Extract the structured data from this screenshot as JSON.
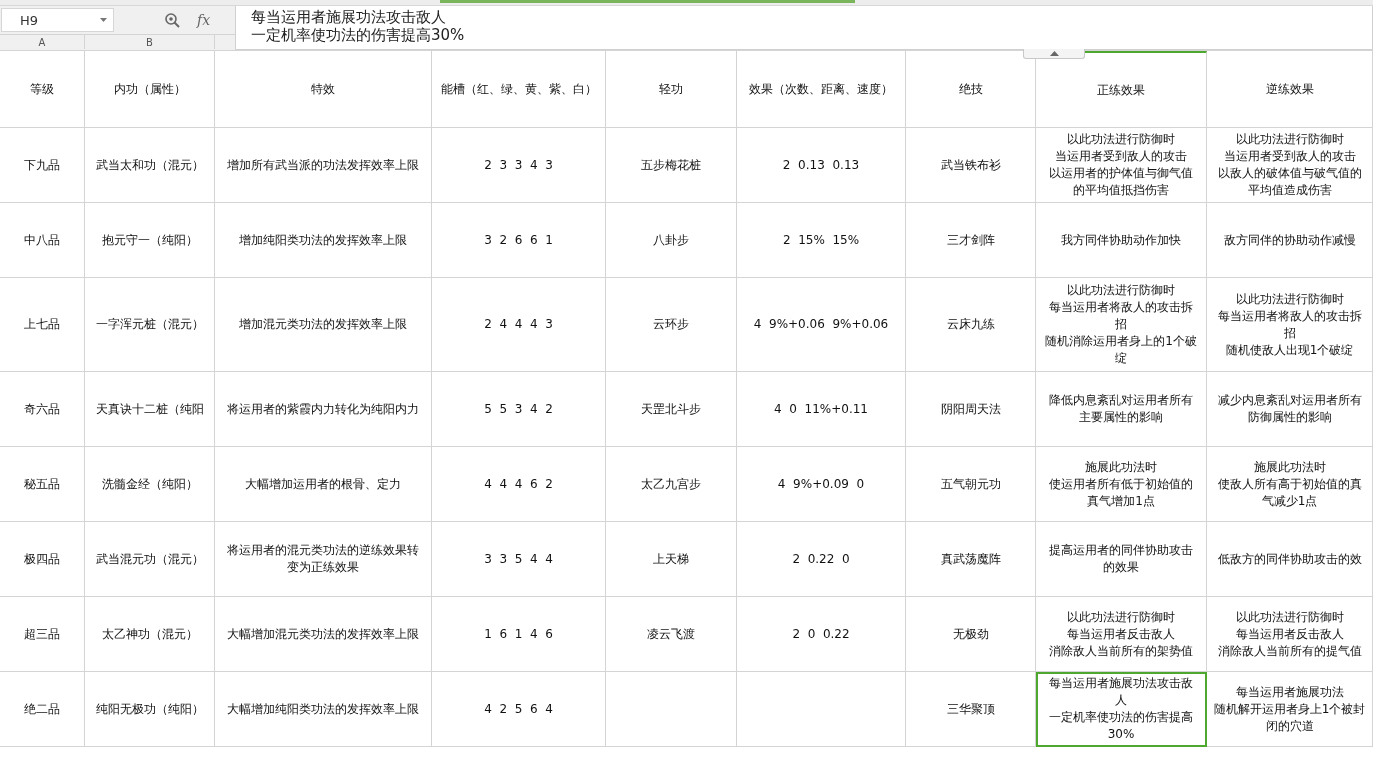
{
  "formula_bar": {
    "cell_ref": "H9",
    "function_button": "fx",
    "content_lines": [
      "每当运用者施展功法攻击敌人",
      "一定机率使功法的伤害提高30%"
    ]
  },
  "column_headers": [
    "A",
    "B"
  ],
  "sheet": {
    "header": [
      "等级",
      "内功（属性）",
      "特效",
      "能槽（红、绿、黄、紫、白）",
      "轻功",
      "效果（次数、距离、速度）",
      "绝技",
      "正练效果",
      "逆练效果"
    ],
    "rows": [
      {
        "cells": [
          {
            "lines": [
              "下九品"
            ],
            "selected": false
          },
          {
            "lines": [
              "武当太和功（混元）"
            ],
            "selected": false
          },
          {
            "lines": [
              "增加所有武当派的功法发挥效率上限"
            ],
            "selected": false
          },
          {
            "lines": [
              "2  3  3  4  3"
            ],
            "selected": false
          },
          {
            "lines": [
              "五步梅花桩"
            ],
            "selected": false
          },
          {
            "lines": [
              "2  0.13  0.13"
            ],
            "selected": false
          },
          {
            "lines": [
              "武当铁布衫"
            ],
            "selected": false
          },
          {
            "lines": [
              "以此功法进行防御时",
              "当运用者受到敌人的攻击",
              "以运用者的护体值与御气值",
              "的平均值抵挡伤害"
            ],
            "selected": false
          },
          {
            "lines": [
              "以此功法进行防御时",
              "当运用者受到敌人的攻击",
              "以敌人的破体值与破气值的",
              "平均值造成伤害"
            ],
            "selected": false
          }
        ]
      },
      {
        "cells": [
          {
            "lines": [
              "中八品"
            ],
            "selected": false
          },
          {
            "lines": [
              "抱元守一（纯阳）"
            ],
            "selected": false
          },
          {
            "lines": [
              "增加纯阳类功法的发挥效率上限"
            ],
            "selected": false
          },
          {
            "lines": [
              "3  2  6  6  1"
            ],
            "selected": false
          },
          {
            "lines": [
              "八卦步"
            ],
            "selected": false
          },
          {
            "lines": [
              "2  15%  15%"
            ],
            "selected": false
          },
          {
            "lines": [
              "三才剑阵"
            ],
            "selected": false
          },
          {
            "lines": [
              "我方同伴协助动作加快"
            ],
            "selected": false
          },
          {
            "lines": [
              "敌方同伴的协助动作减慢"
            ],
            "selected": false
          }
        ]
      },
      {
        "cells": [
          {
            "lines": [
              "上七品"
            ],
            "selected": false
          },
          {
            "lines": [
              "一字浑元桩（混元）"
            ],
            "selected": false
          },
          {
            "lines": [
              "增加混元类功法的发挥效率上限"
            ],
            "selected": false
          },
          {
            "lines": [
              "2  4  4  4  3"
            ],
            "selected": false
          },
          {
            "lines": [
              "云环步"
            ],
            "selected": false
          },
          {
            "lines": [
              "4  9%+0.06  9%+0.06"
            ],
            "selected": false
          },
          {
            "lines": [
              "云床九练"
            ],
            "selected": false
          },
          {
            "lines": [
              "以此功法进行防御时",
              "每当运用者将敌人的攻击拆",
              "招",
              "随机消除运用者身上的1个破",
              "绽"
            ],
            "selected": false
          },
          {
            "lines": [
              "以此功法进行防御时",
              "每当运用者将敌人的攻击拆",
              "招",
              "随机使敌人出现1个破绽"
            ],
            "selected": false
          }
        ]
      },
      {
        "cells": [
          {
            "lines": [
              "奇六品"
            ],
            "selected": false
          },
          {
            "lines": [
              "天真诀十二桩（纯阳"
            ],
            "selected": false
          },
          {
            "lines": [
              "将运用者的紫霞内力转化为纯阳内力"
            ],
            "selected": false
          },
          {
            "lines": [
              "5  5  3  4  2"
            ],
            "selected": false
          },
          {
            "lines": [
              "天罡北斗步"
            ],
            "selected": false
          },
          {
            "lines": [
              "4  0  11%+0.11"
            ],
            "selected": false
          },
          {
            "lines": [
              "阴阳周天法"
            ],
            "selected": false
          },
          {
            "lines": [
              "降低内息紊乱对运用者所有",
              "主要属性的影响"
            ],
            "selected": false
          },
          {
            "lines": [
              "减少内息紊乱对运用者所有",
              "防御属性的影响"
            ],
            "selected": false
          }
        ]
      },
      {
        "cells": [
          {
            "lines": [
              "秘五品"
            ],
            "selected": false
          },
          {
            "lines": [
              "洗髓金经（纯阳）"
            ],
            "selected": false
          },
          {
            "lines": [
              "大幅增加运用者的根骨、定力"
            ],
            "selected": false
          },
          {
            "lines": [
              "4  4  4  6  2"
            ],
            "selected": false
          },
          {
            "lines": [
              "太乙九宫步"
            ],
            "selected": false
          },
          {
            "lines": [
              "4  9%+0.09  0"
            ],
            "selected": false
          },
          {
            "lines": [
              "五气朝元功"
            ],
            "selected": false
          },
          {
            "lines": [
              "施展此功法时",
              "使运用者所有低于初始值的",
              "真气增加1点"
            ],
            "selected": false
          },
          {
            "lines": [
              "施展此功法时",
              "使敌人所有高于初始值的真",
              "气减少1点"
            ],
            "selected": false
          }
        ]
      },
      {
        "cells": [
          {
            "lines": [
              "极四品"
            ],
            "selected": false
          },
          {
            "lines": [
              "武当混元功（混元）"
            ],
            "selected": false
          },
          {
            "lines": [
              "将运用者的混元类功法的逆练效果转",
              "变为正练效果"
            ],
            "selected": false
          },
          {
            "lines": [
              "3  3  5  4  4"
            ],
            "selected": false
          },
          {
            "lines": [
              "上天梯"
            ],
            "selected": false
          },
          {
            "lines": [
              "2  0.22  0"
            ],
            "selected": false
          },
          {
            "lines": [
              "真武荡魔阵"
            ],
            "selected": false
          },
          {
            "lines": [
              "提高运用者的同伴协助攻击",
              "的效果"
            ],
            "selected": false
          },
          {
            "lines": [
              "低敌方的同伴协助攻击的效"
            ],
            "selected": false
          }
        ]
      },
      {
        "cells": [
          {
            "lines": [
              "超三品"
            ],
            "selected": false
          },
          {
            "lines": [
              "太乙神功（混元）"
            ],
            "selected": false
          },
          {
            "lines": [
              "大幅增加混元类功法的发挥效率上限"
            ],
            "selected": false
          },
          {
            "lines": [
              "1  6  1  4  6"
            ],
            "selected": false
          },
          {
            "lines": [
              "凌云飞渡"
            ],
            "selected": false
          },
          {
            "lines": [
              "2  0  0.22"
            ],
            "selected": false
          },
          {
            "lines": [
              "无极劲"
            ],
            "selected": false
          },
          {
            "lines": [
              "以此功法进行防御时",
              "每当运用者反击敌人",
              "消除敌人当前所有的架势值"
            ],
            "selected": false
          },
          {
            "lines": [
              "以此功法进行防御时",
              "每当运用者反击敌人",
              "消除敌人当前所有的提气值"
            ],
            "selected": false
          }
        ]
      },
      {
        "cells": [
          {
            "lines": [
              "绝二品"
            ],
            "selected": false
          },
          {
            "lines": [
              "纯阳无极功（纯阳）"
            ],
            "selected": false
          },
          {
            "lines": [
              "大幅增加纯阳类功法的发挥效率上限"
            ],
            "selected": false
          },
          {
            "lines": [
              "4  2  5  6  4"
            ],
            "selected": false
          },
          {
            "selected": false
          },
          {
            "selected": false
          },
          {
            "lines": [
              "三华聚顶"
            ],
            "selected": false
          },
          {
            "lines": [
              "每当运用者施展功法攻击敌",
              "人",
              "一定机率使功法的伤害提高",
              "30%"
            ],
            "selected": true
          },
          {
            "lines": [
              "每当运用者施展功法",
              "随机解开运用者身上1个被封",
              "闭的穴道"
            ],
            "selected": false
          }
        ]
      }
    ]
  }
}
